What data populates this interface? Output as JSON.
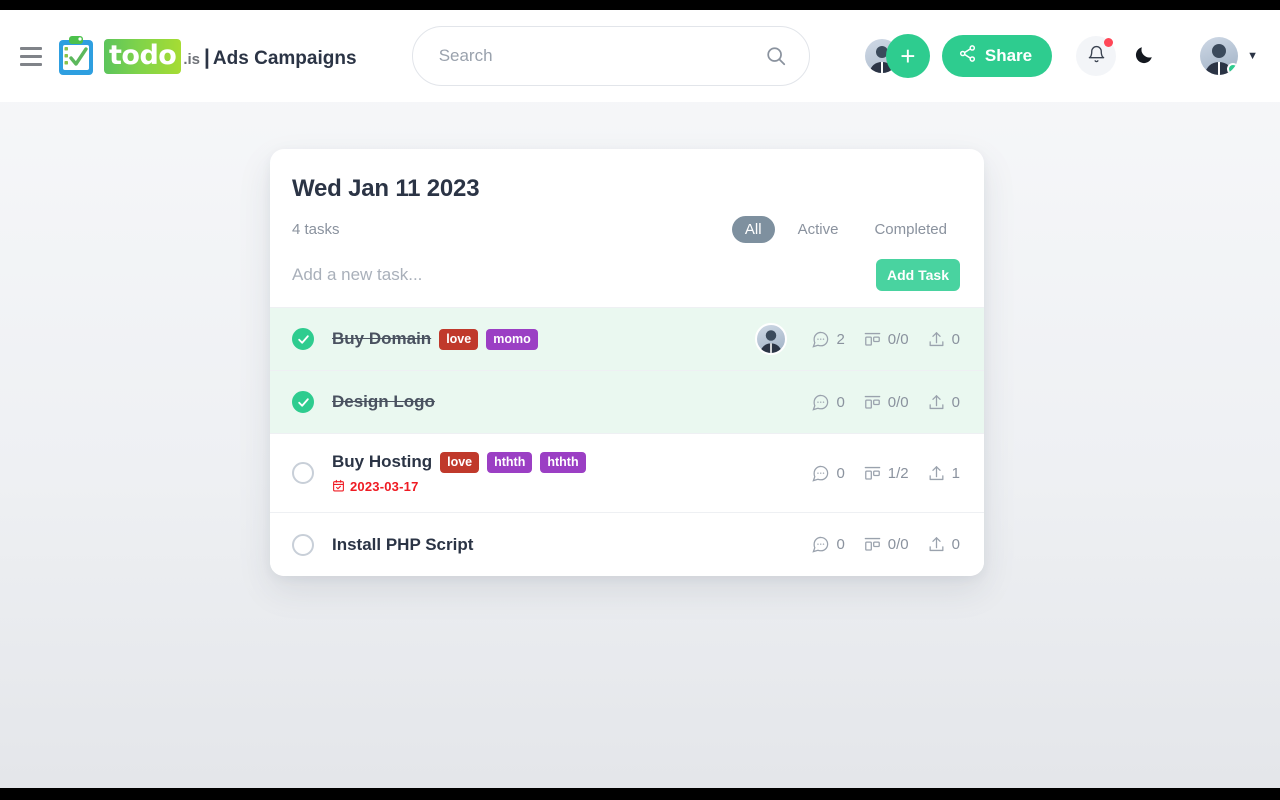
{
  "header": {
    "menu_icon": "hamburger-icon",
    "brand": {
      "logo_icon": "clipboard-check-icon",
      "logo_word": "todo",
      "logo_suffix": ".is",
      "separator": "|",
      "page_title": "Ads Campaigns"
    },
    "search": {
      "placeholder": "Search",
      "value": "",
      "icon": "search-icon"
    },
    "actions": {
      "add_label": "+",
      "share_label": "Share",
      "share_icon": "share-nodes-icon",
      "bell_icon": "bell-icon",
      "bell_has_notification": true,
      "dark_mode_icon": "moon-icon",
      "user_caret": "▼",
      "user_online": true
    }
  },
  "card": {
    "date": "Wed Jan 11 2023",
    "task_count": "4 tasks",
    "filters": [
      {
        "label": "All",
        "active": true
      },
      {
        "label": "Active",
        "active": false
      },
      {
        "label": "Completed",
        "active": false
      }
    ],
    "new_task": {
      "placeholder": "Add a new task...",
      "value": "",
      "button_label": "Add Task"
    },
    "tasks": [
      {
        "title": "Buy Domain",
        "completed": true,
        "tags": [
          {
            "label": "love",
            "color": "#c0392b"
          },
          {
            "label": "momo",
            "color": "#9b3fc4"
          }
        ],
        "due_date": "",
        "has_avatar": true,
        "comments": "2",
        "subtasks": "0/0",
        "attachments": "0"
      },
      {
        "title": "Design Logo",
        "completed": true,
        "tags": [],
        "due_date": "",
        "has_avatar": false,
        "comments": "0",
        "subtasks": "0/0",
        "attachments": "0"
      },
      {
        "title": "Buy Hosting",
        "completed": false,
        "tags": [
          {
            "label": "love",
            "color": "#c0392b"
          },
          {
            "label": "hthth",
            "color": "#9b3fc4"
          },
          {
            "label": "hthth",
            "color": "#9b3fc4"
          }
        ],
        "due_date": "2023-03-17",
        "has_avatar": false,
        "comments": "0",
        "subtasks": "1/2",
        "attachments": "1"
      },
      {
        "title": "Install PHP Script",
        "completed": false,
        "tags": [],
        "due_date": "",
        "has_avatar": false,
        "comments": "0",
        "subtasks": "0/0",
        "attachments": "0"
      }
    ]
  },
  "colors": {
    "accent_green": "#2ecc8f",
    "button_green": "#49d3a0",
    "filter_active": "#7e909f",
    "due_red": "#ef1b23",
    "text_dark": "#2b3445",
    "text_muted": "#8a929e"
  }
}
